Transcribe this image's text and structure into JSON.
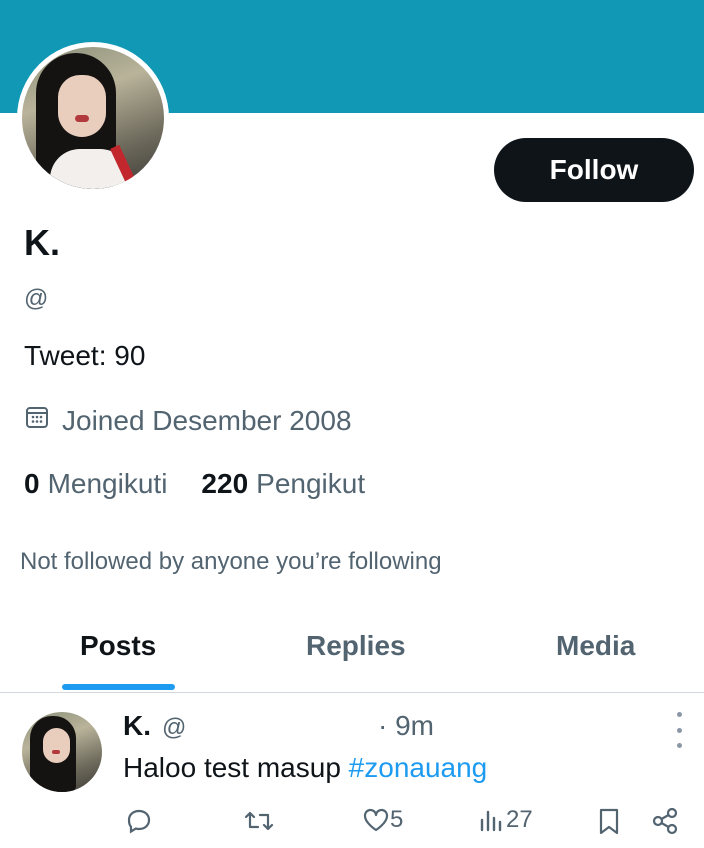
{
  "profile": {
    "follow_label": "Follow",
    "display_name": "K.",
    "handle": "@",
    "tweet_count": "Tweet: 90",
    "joined": "Joined Desember 2008",
    "following_count": "0",
    "following_label": "Mengikuti",
    "followers_count": "220",
    "followers_label": "Pengikut",
    "not_followed_text": "Not followed by anyone you’re following",
    "banner_color": "#1098b5"
  },
  "tabs": [
    {
      "label": "Posts",
      "active": true
    },
    {
      "label": "Replies",
      "active": false
    },
    {
      "label": "Media",
      "active": false
    }
  ],
  "post": {
    "name": "K.",
    "handle": "@",
    "time": "· 9m",
    "text": "Haloo test masup",
    "hashtag": "#zonauang",
    "likes": "5",
    "views": "27",
    "icons": [
      "reply-icon",
      "retweet-icon",
      "like-icon",
      "views-icon",
      "bookmark-icon",
      "share-icon",
      "more-icon"
    ]
  },
  "colors": {
    "accent": "#1d9bf0",
    "text_primary": "#0f1419",
    "text_secondary": "#536471"
  }
}
